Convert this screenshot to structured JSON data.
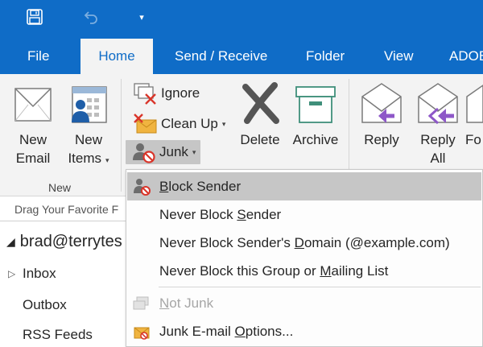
{
  "quick_access": {
    "save_icon": "save-icon",
    "undo_icon": "undo-icon",
    "more_icon": "customize-toolbar-icon",
    "more_glyph": "▾"
  },
  "tabs": [
    {
      "label": "File",
      "active": false
    },
    {
      "label": "Home",
      "active": true
    },
    {
      "label": "Send / Receive",
      "active": false
    },
    {
      "label": "Folder",
      "active": false
    },
    {
      "label": "View",
      "active": false
    },
    {
      "label": "ADOB",
      "active": false
    }
  ],
  "ribbon": {
    "new_group": {
      "label": "New",
      "new_email": {
        "line1": "New",
        "line2": "Email"
      },
      "new_items": {
        "line1": "New",
        "line2": "Items",
        "caret": "▾"
      }
    },
    "delete_group": {
      "ignore": "Ignore",
      "clean_up": "Clean Up",
      "clean_up_caret": "▾",
      "junk": "Junk",
      "junk_caret": "▾",
      "delete": "Delete",
      "archive": "Archive"
    },
    "respond_group": {
      "reply": "Reply",
      "reply_all": {
        "line1": "Reply",
        "line2": "All"
      },
      "forward_partial": "Fo"
    }
  },
  "folder_pane": {
    "drag_hint": "Drag Your Favorite F",
    "account": "brad@terrytes",
    "folders": [
      "Inbox",
      "Outbox",
      "RSS Feeds"
    ],
    "expander_glyph": "▷",
    "account_chevron": "◢"
  },
  "junk_menu": {
    "items": [
      {
        "pre": "",
        "u": "B",
        "post": "lock Sender",
        "icon": "block-sender-icon",
        "state": "highlighted"
      },
      {
        "pre": "Never Block ",
        "u": "S",
        "post": "ender",
        "icon": "",
        "state": "normal"
      },
      {
        "pre": "Never Block Sender's ",
        "u": "D",
        "post": "omain (@example.com)",
        "icon": "",
        "state": "normal"
      },
      {
        "pre": "Never Block this Group or ",
        "u": "M",
        "post": "ailing List",
        "icon": "",
        "state": "normal"
      },
      {
        "pre": "",
        "u": "N",
        "post": "ot Junk",
        "icon": "not-junk-icon",
        "state": "disabled"
      },
      {
        "pre": "Junk E-mail ",
        "u": "O",
        "post": "ptions...",
        "icon": "junk-options-icon",
        "state": "normal"
      }
    ]
  },
  "colors": {
    "accent": "#0f6cc7",
    "ribbon_bg": "#f3f3f3",
    "highlight": "#c6c6c6",
    "reply_arrow": "#8e58c8",
    "block_red": "#d9352a",
    "envelope_yellow": "#f0b440"
  }
}
